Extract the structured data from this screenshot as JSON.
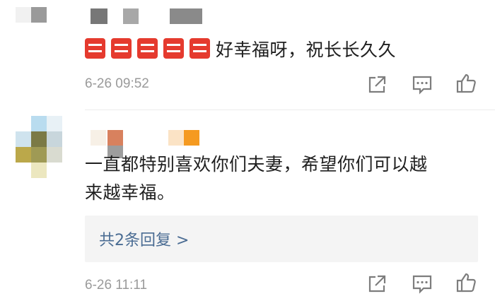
{
  "comments": [
    {
      "emoji_count": 5,
      "emoji_icon": "double-happiness-icon",
      "text": "好幸福呀，祝长长久久",
      "time": "6-26 09:52"
    },
    {
      "text_line1": "一直都特别喜欢你们夫妻，希望你们可以越",
      "text_line2": "来越幸福。",
      "replies_label": "共2条回复 >",
      "time": "6-26 11:11"
    }
  ],
  "colors": {
    "reply_link": "#4a6c93",
    "meta_gray": "#9a9a9a",
    "emoji_red": "#e53a2e"
  }
}
